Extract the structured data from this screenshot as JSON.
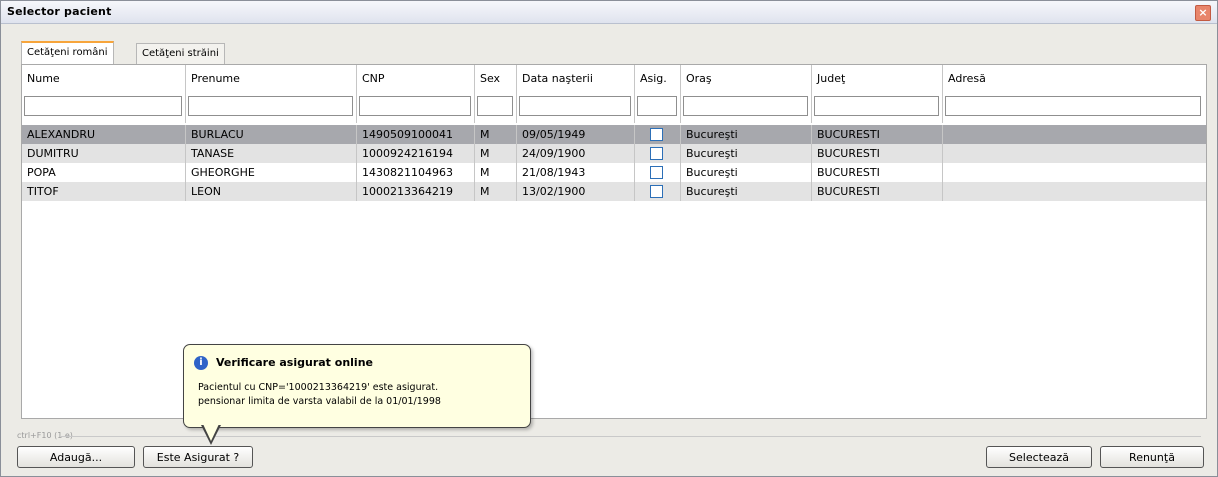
{
  "window": {
    "title": "Selector pacient",
    "close": "×"
  },
  "tabs": [
    {
      "label": "Cetăţeni români",
      "active": true
    },
    {
      "label": "Cetăţeni străini",
      "active": false
    }
  ],
  "columns": [
    "Nume",
    "Prenume",
    "CNP",
    "Sex",
    "Data naşterii",
    "Asig.",
    "Oraş",
    "Judeţ",
    "Adresă"
  ],
  "rows": [
    {
      "nume": "ALEXANDRU",
      "prenume": "BURLACU",
      "cnp": "1490509100041",
      "sex": "M",
      "data": "09/05/1949",
      "asig": false,
      "oras": "Bucureşti",
      "judet": "BUCURESTI",
      "adresa": ""
    },
    {
      "nume": "DUMITRU",
      "prenume": "TANASE",
      "cnp": "1000924216194",
      "sex": "M",
      "data": "24/09/1900",
      "asig": false,
      "oras": "Bucureşti",
      "judet": "BUCURESTI",
      "adresa": ""
    },
    {
      "nume": "POPA",
      "prenume": "GHEORGHE",
      "cnp": "1430821104963",
      "sex": "M",
      "data": "21/08/1943",
      "asig": false,
      "oras": "Bucureşti",
      "judet": "BUCURESTI",
      "adresa": ""
    },
    {
      "nume": "TITOF",
      "prenume": "LEON",
      "cnp": "1000213364219",
      "sex": "M",
      "data": "13/02/1900",
      "asig": false,
      "oras": "Bucureşti",
      "judet": "BUCURESTI",
      "adresa": ""
    }
  ],
  "tooltip": {
    "title": "Verificare asigurat online",
    "line1": "Pacientul cu CNP='1000213364219' este asigurat.",
    "line2": "pensionar limita de varsta valabil de la 01/01/1998"
  },
  "separator_label": "ctrl+F10 (1 e)",
  "buttons": {
    "add": "Adaugă...",
    "check": "Este Asigurat ?",
    "select": "Selectează",
    "cancel": "Renunţă"
  }
}
